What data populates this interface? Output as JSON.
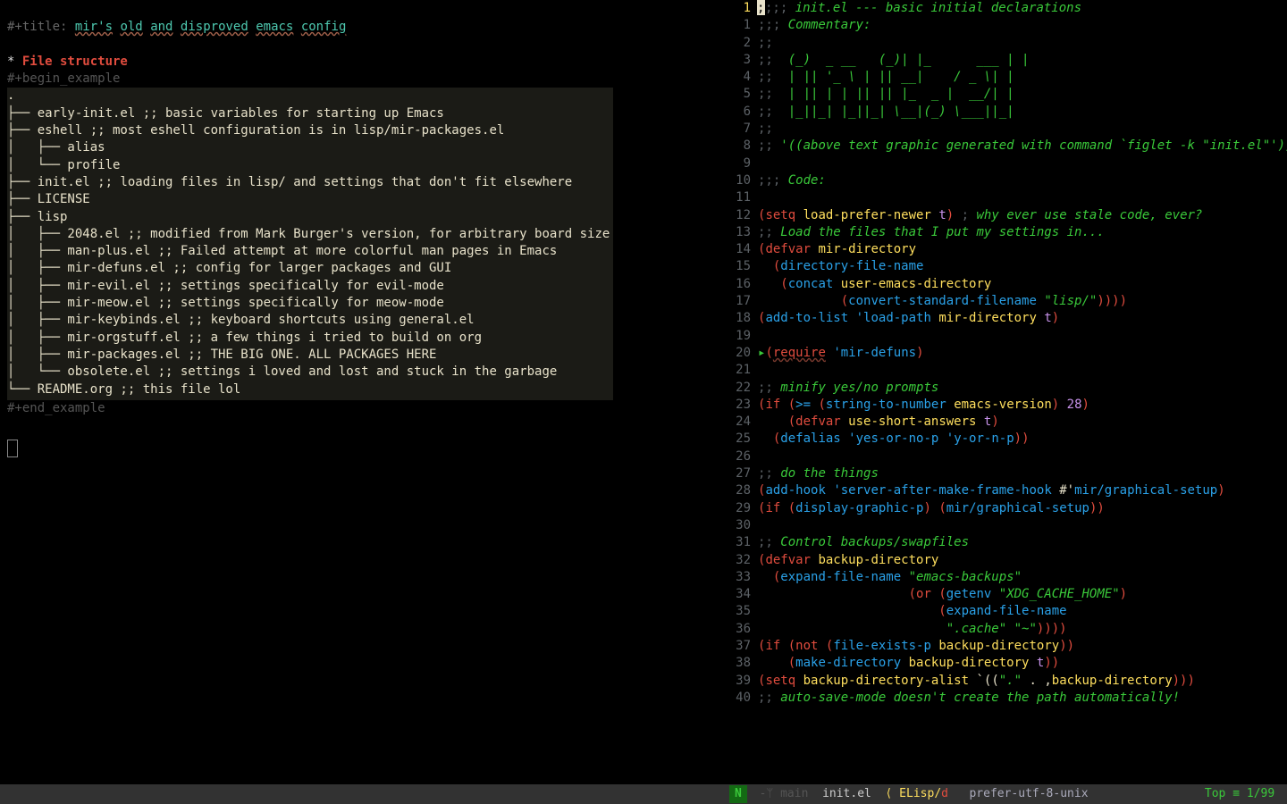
{
  "left": {
    "title_key": "#+title: ",
    "title_words": [
      "mir's",
      "old",
      "and",
      "disproved",
      "emacs",
      "config"
    ],
    "h1_star": "* ",
    "h1": "File structure",
    "begin": "#+begin_example",
    "end": "#+end_example",
    "tree": [
      ".",
      "├── early-init.el ;; basic variables for starting up Emacs",
      "├── eshell ;; most eshell configuration is in lisp/mir-packages.el",
      "│   ├── alias",
      "│   └── profile",
      "├── init.el ;; loading files in lisp/ and settings that don't fit elsewhere",
      "├── LICENSE",
      "├── lisp",
      "│   ├── 2048.el ;; modified from Mark Burger's version, for arbitrary board size",
      "│   ├── man-plus.el ;; Failed attempt at more colorful man pages in Emacs",
      "│   ├── mir-defuns.el ;; config for larger packages and GUI",
      "│   ├── mir-evil.el ;; settings specifically for evil-mode",
      "│   ├── mir-meow.el ;; settings specifically for meow-mode",
      "│   ├── mir-keybinds.el ;; keyboard shortcuts using general.el",
      "│   ├── mir-orgstuff.el ;; a few things i tried to build on org",
      "│   ├── mir-packages.el ;; THE BIG ONE. ALL PACKAGES HERE",
      "│   └── obsolete.el ;; settings i loved and lost and stuck in the garbage",
      "└── README.org ;; this file lol"
    ]
  },
  "right": {
    "lines": [
      {
        "n": 1,
        "cur": true,
        "html": [
          [
            "semi",
            ";;; "
          ],
          [
            "header-cmt",
            "init.el --- basic initial declarations"
          ]
        ]
      },
      {
        "n": 1,
        "html": [
          [
            "semi",
            ";;; "
          ],
          [
            "header-cmt",
            "Commentary:"
          ]
        ]
      },
      {
        "n": 2,
        "html": [
          [
            "semi",
            ";;"
          ]
        ]
      },
      {
        "n": 3,
        "html": [
          [
            "semi",
            ";;  "
          ],
          [
            "header-cmt",
            "(_)  _ __   (_)| |_      ___ | |"
          ]
        ]
      },
      {
        "n": 4,
        "html": [
          [
            "semi",
            ";;  "
          ],
          [
            "header-cmt",
            "| || '_ \\ | || __|    / _ \\| |"
          ]
        ]
      },
      {
        "n": 5,
        "html": [
          [
            "semi",
            ";;  "
          ],
          [
            "header-cmt",
            "| || | | || || |_  _ |  __/| |"
          ]
        ]
      },
      {
        "n": 6,
        "html": [
          [
            "semi",
            ";;  "
          ],
          [
            "header-cmt",
            "|_||_| |_||_| \\__|(_) \\___||_|"
          ]
        ]
      },
      {
        "n": 7,
        "html": [
          [
            "semi",
            ";;"
          ]
        ]
      },
      {
        "n": 8,
        "html": [
          [
            "semi",
            ";; "
          ],
          [
            "header-cmt",
            "'((above text graphic generated with command `figlet -k \"init.el\"'))"
          ]
        ]
      },
      {
        "n": 9,
        "html": []
      },
      {
        "n": 10,
        "html": [
          [
            "semi",
            ";;; "
          ],
          [
            "header-cmt",
            "Code:"
          ]
        ]
      },
      {
        "n": 11,
        "html": []
      },
      {
        "n": 12,
        "html": [
          [
            "paren",
            "("
          ],
          [
            "kw",
            "setq"
          ],
          [
            "",
            " "
          ],
          [
            "var",
            "load-prefer-newer"
          ],
          [
            "",
            " "
          ],
          [
            "true",
            "t"
          ],
          [
            "paren",
            ")"
          ],
          [
            "",
            " "
          ],
          [
            "semi",
            "; "
          ],
          [
            "header-cmt",
            "why ever use stale code, ever?"
          ]
        ]
      },
      {
        "n": 13,
        "html": [
          [
            "semi",
            ";; "
          ],
          [
            "header-cmt",
            "Load the files that I put my settings in..."
          ]
        ]
      },
      {
        "n": 14,
        "html": [
          [
            "paren",
            "("
          ],
          [
            "kw",
            "defvar"
          ],
          [
            "",
            " "
          ],
          [
            "var",
            "mir-directory"
          ]
        ]
      },
      {
        "n": 15,
        "html": [
          [
            "",
            "  "
          ],
          [
            "paren",
            "("
          ],
          [
            "fn",
            "directory-file-name"
          ]
        ]
      },
      {
        "n": 16,
        "html": [
          [
            "",
            "   "
          ],
          [
            "paren",
            "("
          ],
          [
            "fn",
            "concat"
          ],
          [
            "",
            " "
          ],
          [
            "var",
            "user-emacs-directory"
          ]
        ]
      },
      {
        "n": 17,
        "html": [
          [
            "",
            "           "
          ],
          [
            "paren",
            "("
          ],
          [
            "fn",
            "convert-standard-filename"
          ],
          [
            "",
            " "
          ],
          [
            "str",
            "\"lisp/\""
          ],
          [
            "paren",
            "))))"
          ]
        ]
      },
      {
        "n": 18,
        "html": [
          [
            "paren",
            "("
          ],
          [
            "fn",
            "add-to-list"
          ],
          [
            "",
            " "
          ],
          [
            "quote",
            "'"
          ],
          [
            "sym",
            "load-path"
          ],
          [
            "",
            " "
          ],
          [
            "var",
            "mir-directory"
          ],
          [
            "",
            " "
          ],
          [
            "true",
            "t"
          ],
          [
            "paren",
            ")"
          ]
        ]
      },
      {
        "n": 19,
        "html": []
      },
      {
        "n": 20,
        "arrow": true,
        "html": [
          [
            "paren",
            "("
          ],
          [
            "kw underline-req",
            "require"
          ],
          [
            "",
            " "
          ],
          [
            "quote",
            "'"
          ],
          [
            "sym",
            "mir-defuns"
          ],
          [
            "paren",
            ")"
          ]
        ]
      },
      {
        "n": 21,
        "html": []
      },
      {
        "n": 22,
        "html": [
          [
            "semi",
            ";; "
          ],
          [
            "header-cmt",
            "minify yes/no prompts"
          ]
        ]
      },
      {
        "n": 23,
        "html": [
          [
            "paren",
            "("
          ],
          [
            "kw",
            "if"
          ],
          [
            "",
            " "
          ],
          [
            "paren",
            "("
          ],
          [
            "fn",
            ">="
          ],
          [
            "",
            " "
          ],
          [
            "paren",
            "("
          ],
          [
            "fn",
            "string-to-number"
          ],
          [
            "",
            " "
          ],
          [
            "var",
            "emacs-version"
          ],
          [
            "paren",
            ")"
          ],
          [
            "",
            " "
          ],
          [
            "num",
            "28"
          ],
          [
            "paren",
            ")"
          ]
        ]
      },
      {
        "n": 24,
        "html": [
          [
            "",
            "    "
          ],
          [
            "paren",
            "("
          ],
          [
            "kw",
            "defvar"
          ],
          [
            "",
            " "
          ],
          [
            "var",
            "use-short-answers"
          ],
          [
            "",
            " "
          ],
          [
            "true",
            "t"
          ],
          [
            "paren",
            ")"
          ]
        ]
      },
      {
        "n": 25,
        "html": [
          [
            "",
            "  "
          ],
          [
            "paren",
            "("
          ],
          [
            "fn",
            "defalias"
          ],
          [
            "",
            " "
          ],
          [
            "quote",
            "'"
          ],
          [
            "sym",
            "yes-or-no-p"
          ],
          [
            "",
            " "
          ],
          [
            "quote",
            "'"
          ],
          [
            "sym",
            "y-or-n-p"
          ],
          [
            "paren",
            "))"
          ]
        ]
      },
      {
        "n": 26,
        "html": []
      },
      {
        "n": 27,
        "html": [
          [
            "semi",
            ";; "
          ],
          [
            "header-cmt",
            "do the things"
          ]
        ]
      },
      {
        "n": 28,
        "html": [
          [
            "paren",
            "("
          ],
          [
            "fn",
            "add-hook"
          ],
          [
            "",
            " "
          ],
          [
            "quote",
            "'"
          ],
          [
            "sym",
            "server-after-make-frame-hook"
          ],
          [
            "",
            " #'"
          ],
          [
            "sym",
            "mir/graphical-setup"
          ],
          [
            "paren",
            ")"
          ]
        ]
      },
      {
        "n": 29,
        "html": [
          [
            "paren",
            "("
          ],
          [
            "kw",
            "if"
          ],
          [
            "",
            " "
          ],
          [
            "paren",
            "("
          ],
          [
            "fn",
            "display-graphic-p"
          ],
          [
            "paren",
            ")"
          ],
          [
            "",
            " "
          ],
          [
            "paren",
            "("
          ],
          [
            "fn",
            "mir/graphical-setup"
          ],
          [
            "paren",
            "))"
          ]
        ]
      },
      {
        "n": 30,
        "html": []
      },
      {
        "n": 31,
        "html": [
          [
            "semi",
            ";; "
          ],
          [
            "header-cmt",
            "Control backups/swapfiles"
          ]
        ]
      },
      {
        "n": 32,
        "html": [
          [
            "paren",
            "("
          ],
          [
            "kw",
            "defvar"
          ],
          [
            "",
            " "
          ],
          [
            "var",
            "backup-directory"
          ]
        ]
      },
      {
        "n": 33,
        "html": [
          [
            "",
            "  "
          ],
          [
            "paren",
            "("
          ],
          [
            "fn",
            "expand-file-name"
          ],
          [
            "",
            " "
          ],
          [
            "str",
            "\"emacs-backups\""
          ]
        ]
      },
      {
        "n": 34,
        "html": [
          [
            "",
            "                    "
          ],
          [
            "paren",
            "("
          ],
          [
            "kw",
            "or"
          ],
          [
            "",
            " "
          ],
          [
            "paren",
            "("
          ],
          [
            "fn",
            "getenv"
          ],
          [
            "",
            " "
          ],
          [
            "str",
            "\"XDG_CACHE_HOME\""
          ],
          [
            "paren",
            ")"
          ]
        ]
      },
      {
        "n": 35,
        "html": [
          [
            "",
            "                        "
          ],
          [
            "paren",
            "("
          ],
          [
            "fn",
            "expand-file-name"
          ]
        ]
      },
      {
        "n": 36,
        "html": [
          [
            "",
            "                         "
          ],
          [
            "str",
            "\".cache\""
          ],
          [
            "",
            " "
          ],
          [
            "str",
            "\"~\""
          ],
          [
            "paren",
            "))))"
          ]
        ]
      },
      {
        "n": 37,
        "html": [
          [
            "paren",
            "("
          ],
          [
            "kw",
            "if"
          ],
          [
            "",
            " "
          ],
          [
            "paren",
            "("
          ],
          [
            "kw",
            "not"
          ],
          [
            "",
            " "
          ],
          [
            "paren",
            "("
          ],
          [
            "fn",
            "file-exists-p"
          ],
          [
            "",
            " "
          ],
          [
            "var",
            "backup-directory"
          ],
          [
            "paren",
            "))"
          ]
        ]
      },
      {
        "n": 38,
        "html": [
          [
            "",
            "    "
          ],
          [
            "paren",
            "("
          ],
          [
            "fn",
            "make-directory"
          ],
          [
            "",
            " "
          ],
          [
            "var",
            "backup-directory"
          ],
          [
            "",
            " "
          ],
          [
            "true",
            "t"
          ],
          [
            "paren",
            "))"
          ]
        ]
      },
      {
        "n": 39,
        "html": [
          [
            "paren",
            "("
          ],
          [
            "kw",
            "setq"
          ],
          [
            "",
            " "
          ],
          [
            "var",
            "backup-directory-alist"
          ],
          [
            "",
            " `(("
          ],
          [
            "str",
            "\".\""
          ],
          [
            "",
            " . ,"
          ],
          [
            "var",
            "backup-directory"
          ],
          [
            "paren",
            ")))"
          ]
        ]
      },
      {
        "n": 40,
        "html": [
          [
            "semi",
            ";; "
          ],
          [
            "header-cmt",
            "auto-save-mode doesn't create the path automatically!"
          ]
        ]
      }
    ]
  },
  "modeline": {
    "N": "N",
    "branch": " -ᛘ main ",
    "file": " init.el ",
    "langL": " ⟨ ELisp",
    "langSlash": "/",
    "langD": "d",
    "enc": "   prefer-utf-8-unix ",
    "pos": " Top ≡ 1/99 "
  }
}
